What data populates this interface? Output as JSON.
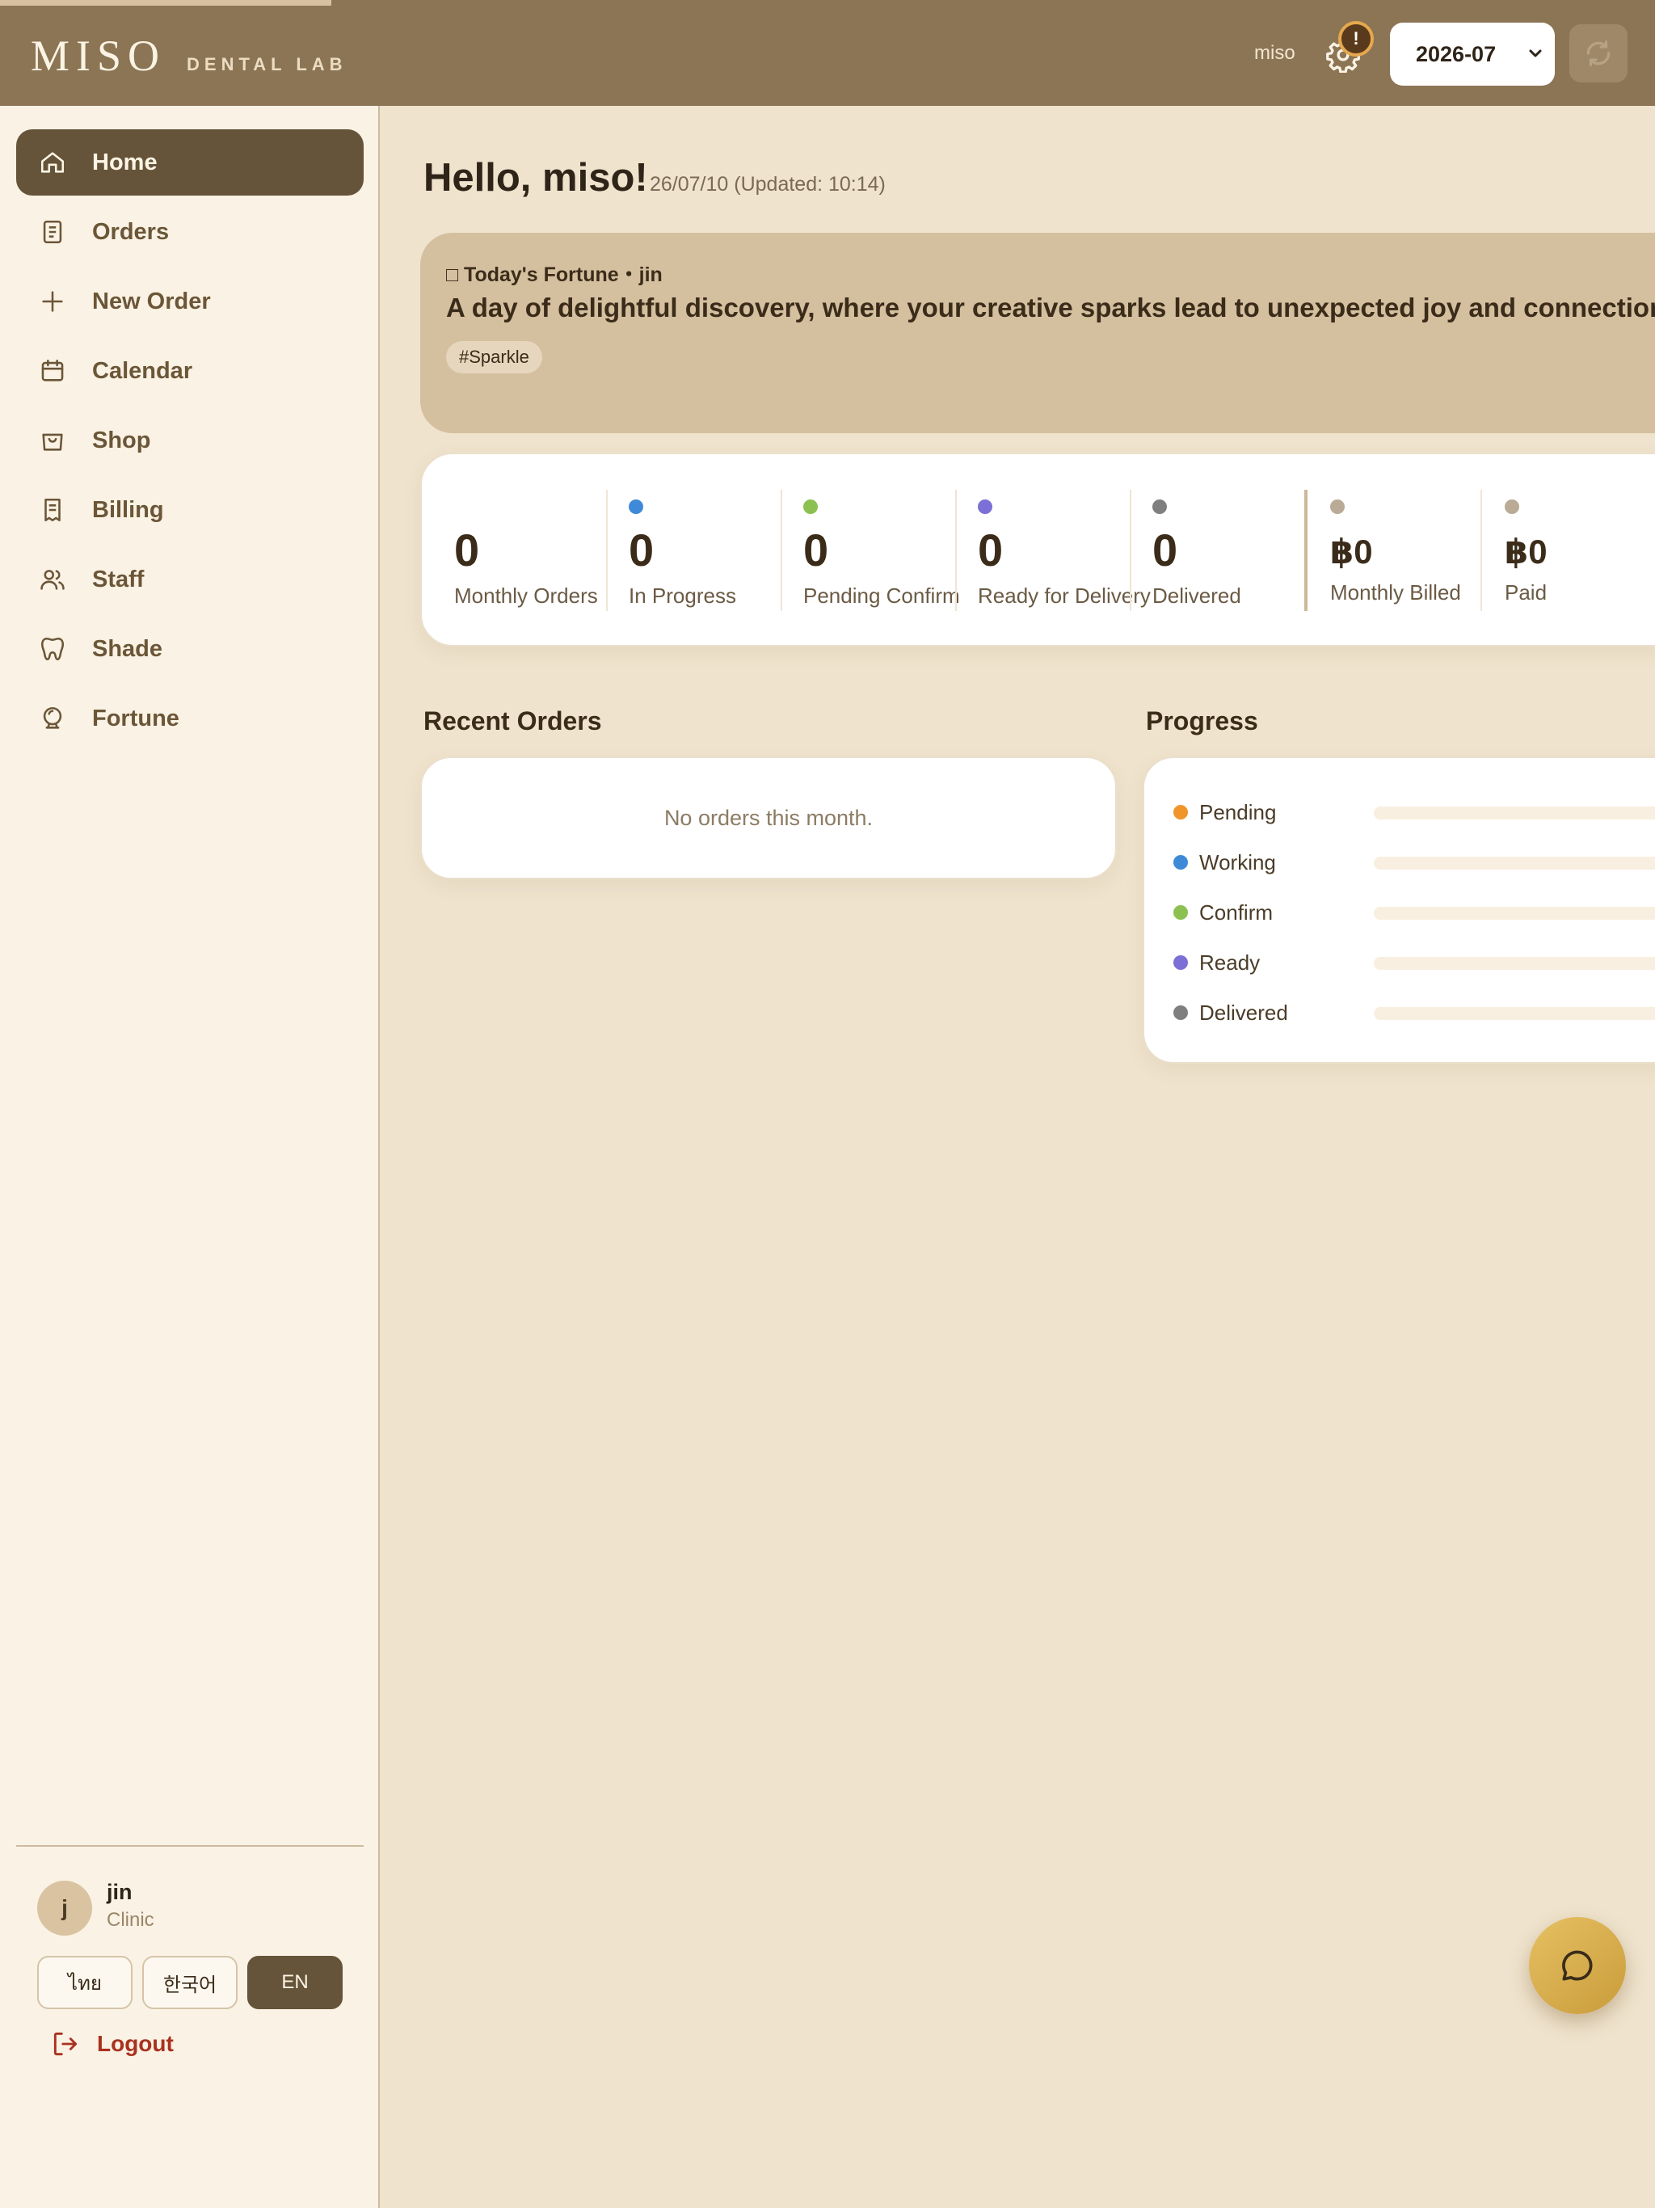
{
  "topbar": {
    "logo": "MISO",
    "logo_sub": "DENTAL LAB",
    "user": "miso",
    "notification_badge": "!",
    "month": "2026-07"
  },
  "sidebar": {
    "items": [
      {
        "label": "Home",
        "icon": "home-icon",
        "active": true
      },
      {
        "label": "Orders",
        "icon": "document-icon"
      },
      {
        "label": "New Order",
        "icon": "plus-icon"
      },
      {
        "label": "Calendar",
        "icon": "calendar-icon"
      },
      {
        "label": "Shop",
        "icon": "shopping-bag-icon"
      },
      {
        "label": "Billing",
        "icon": "receipt-icon"
      },
      {
        "label": "Staff",
        "icon": "users-icon"
      },
      {
        "label": "Shade",
        "icon": "tooth-icon"
      },
      {
        "label": "Fortune",
        "icon": "crystal-ball-icon"
      }
    ],
    "user": {
      "initial": "j",
      "name": "jin",
      "role": "Clinic"
    },
    "languages": [
      {
        "label": "ไทย",
        "active": false
      },
      {
        "label": "한국어",
        "active": false
      },
      {
        "label": "EN",
        "active": true
      }
    ],
    "logout": "Logout"
  },
  "main": {
    "greeting": "Hello, miso!",
    "date": "26/07/10 (Updated: 10:14)",
    "fortune": {
      "header": "□ Today's Fortune・jin",
      "text": "A day of delightful discovery, where your creative sparks lead to unexpected joy and connection.",
      "tag": "#Sparkle"
    },
    "stats": [
      {
        "value": "0",
        "label": "Monthly Orders",
        "dot": ""
      },
      {
        "value": "0",
        "label": "In Progress",
        "dot": "#3f8ad8"
      },
      {
        "value": "0",
        "label": "Pending Confirm",
        "dot": "#8cc152"
      },
      {
        "value": "0",
        "label": "Ready for Delivery",
        "dot": "#7c6fd6"
      },
      {
        "value": "0",
        "label": "Delivered",
        "dot": "#7f7f7f"
      },
      {
        "value": "฿0",
        "label": "Monthly Billed",
        "dot": "#b9ab95"
      },
      {
        "value": "฿0",
        "label": "Paid",
        "dot": "#b9ab95"
      }
    ],
    "recent_orders": {
      "title": "Recent Orders",
      "empty": "No orders this month."
    },
    "progress": {
      "title": "Progress",
      "rows": [
        {
          "label": "Pending",
          "color": "#f0952a",
          "value": 0
        },
        {
          "label": "Working",
          "color": "#3f8ad8",
          "value": 0
        },
        {
          "label": "Confirm",
          "color": "#8cc152",
          "value": 0
        },
        {
          "label": "Ready",
          "color": "#7c6fd6",
          "value": 0
        },
        {
          "label": "Delivered",
          "color": "#7f7f7f",
          "value": 0
        }
      ]
    }
  },
  "colors": {
    "topbar": "#8c7555",
    "sidebar_bg": "#faf2e4",
    "active_nav": "#655439",
    "fortune_card": "#d4bf9f",
    "logout": "#a8321f",
    "chat_fab": "#d9b04f"
  }
}
